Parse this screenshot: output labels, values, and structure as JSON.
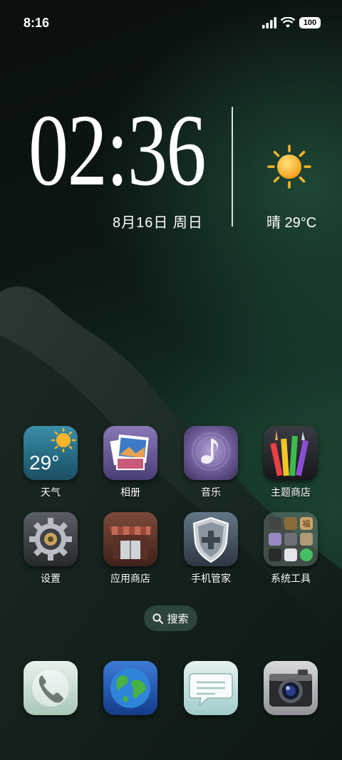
{
  "status_bar": {
    "time": "8:16",
    "battery": "100"
  },
  "clock_widget": {
    "time": "02:36",
    "date": "8月16日 周日",
    "weather": "晴 29°C"
  },
  "apps": [
    {
      "label": "天气",
      "icon": "weather-icon",
      "temp": "29°"
    },
    {
      "label": "相册",
      "icon": "photos-icon"
    },
    {
      "label": "音乐",
      "icon": "music-icon"
    },
    {
      "label": "主题商店",
      "icon": "theme-store-icon"
    },
    {
      "label": "设置",
      "icon": "gear-icon"
    },
    {
      "label": "应用商店",
      "icon": "app-store-icon"
    },
    {
      "label": "手机管家",
      "icon": "shield-icon"
    },
    {
      "label": "系统工具",
      "icon": "folder-icon",
      "folder_tag": "福"
    }
  ],
  "search": {
    "label": "搜索"
  },
  "dock": [
    {
      "icon": "phone-icon"
    },
    {
      "icon": "browser-globe-icon"
    },
    {
      "icon": "messages-icon"
    },
    {
      "icon": "camera-icon"
    }
  ]
}
